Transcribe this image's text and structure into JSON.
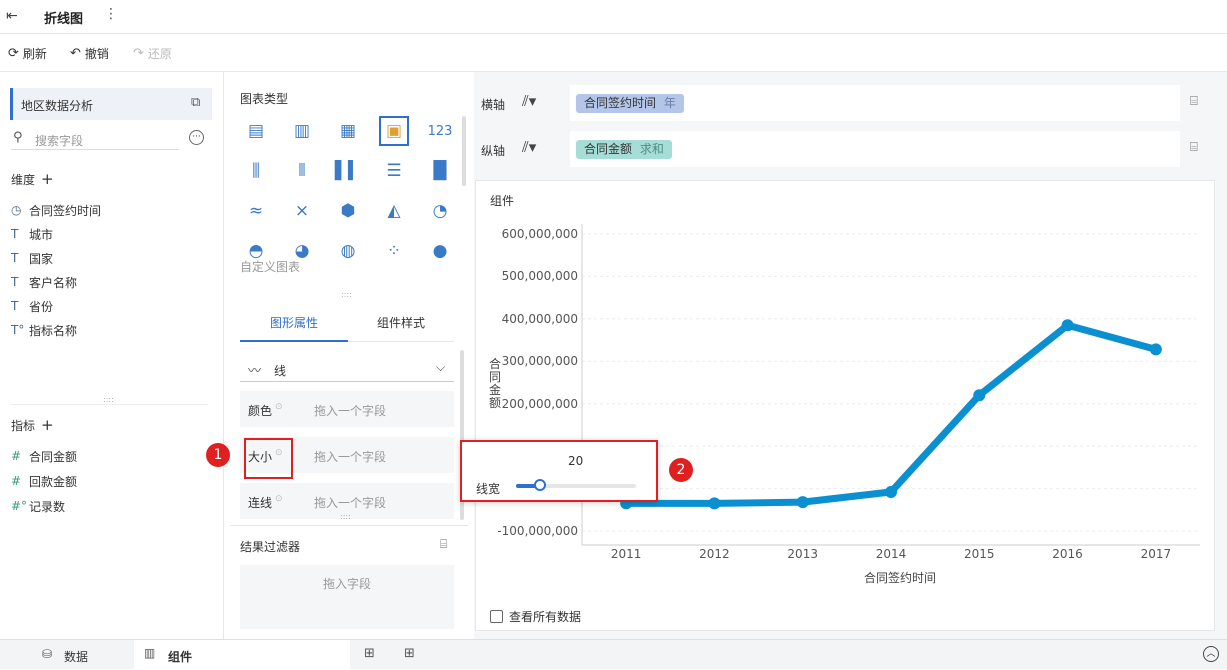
{
  "topbar": {
    "title": "折线图",
    "more_icon": "more-vertical-icon",
    "exit_icon": "exit-icon"
  },
  "toolbar": {
    "refresh": "刷新",
    "undo": "撤销",
    "redo": "还原"
  },
  "left": {
    "dataset": "地区数据分析",
    "search_placeholder": "搜索字段",
    "dimension_title": "维度",
    "dimensions": [
      "合同签约时间",
      "城市",
      "国家",
      "客户名称",
      "省份",
      "指标名称"
    ],
    "measure_title": "指标",
    "measures": [
      "合同金额",
      "回款金额",
      "记录数"
    ]
  },
  "middle": {
    "chart_type_title": "图表类型",
    "custom_chart": "自定义图表",
    "tab_graph_props": "图形属性",
    "tab_component_style": "组件样式",
    "line_type": "线",
    "color_label": "颜色",
    "size_label": "大小",
    "connect_label": "连线",
    "drop_field": "拖入一个字段",
    "filter_title": "结果过滤器",
    "filter_drop": "拖入字段"
  },
  "axes": {
    "x_label": "横轴",
    "y_label": "纵轴",
    "x_field": "合同签约时间",
    "x_field_suffix": "年",
    "y_field": "合同金额",
    "y_field_suffix": "求和",
    "x_pill_color": "#b3c6ea",
    "y_pill_color": "#a6ddd6"
  },
  "chart_panel": {
    "component_title": "组件",
    "view_all": "查看所有数据",
    "popup": {
      "value": "20",
      "label": "线宽",
      "slider_fraction": 0.2
    },
    "markers": [
      "1",
      "2"
    ]
  },
  "chart_data": {
    "type": "line",
    "x": [
      "2011",
      "2012",
      "2013",
      "2014",
      "2015",
      "2016",
      "2017"
    ],
    "series": [
      {
        "values": [
          -35000000,
          -35000000,
          -32000000,
          -8000000,
          220000000,
          385000000,
          328000000
        ]
      }
    ],
    "y_ticks": [
      "600,000,000",
      "500,000,000",
      "400,000,000",
      "300,000,000",
      "200,000,000",
      "-100,000,000"
    ],
    "xlabel": "合同签约时间",
    "ylabel": "合同金额",
    "ylim": [
      -100000000,
      600000000
    ],
    "line_color": "#0a8fd0",
    "grid": true
  },
  "bottom": {
    "data_tab": "数据",
    "component_tab": "组件"
  }
}
